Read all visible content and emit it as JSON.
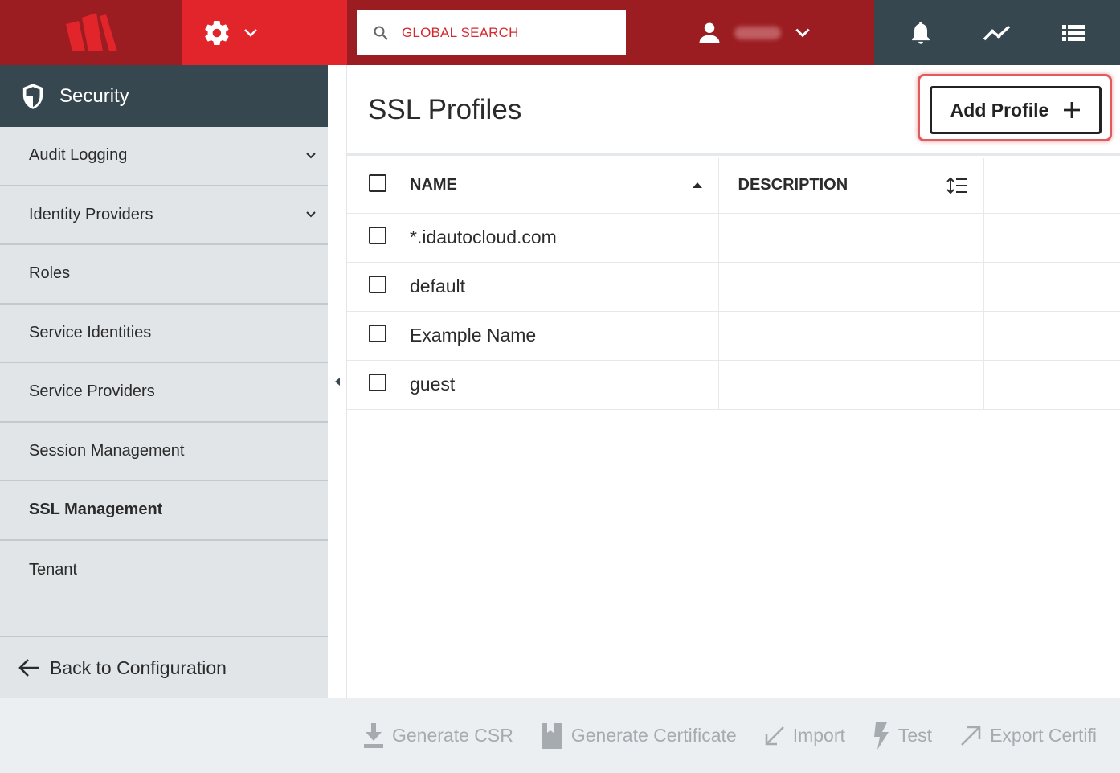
{
  "topbar": {
    "search": {
      "placeholder": "GLOBAL SEARCH"
    },
    "icons": [
      "logo-icon",
      "gear-icon",
      "chevron-down-icon",
      "search-icon",
      "user-icon",
      "bell-icon",
      "activity-icon",
      "list-icon"
    ]
  },
  "sidebar": {
    "title": "Security",
    "items": [
      {
        "label": "Audit Logging",
        "expandable": true
      },
      {
        "label": "Identity Providers",
        "expandable": true
      },
      {
        "label": "Roles",
        "expandable": false
      },
      {
        "label": "Service Identities",
        "expandable": false
      },
      {
        "label": "Service Providers",
        "expandable": false
      },
      {
        "label": "Session Management",
        "expandable": false
      },
      {
        "label": "SSL Management",
        "expandable": false,
        "active": true
      },
      {
        "label": "Tenant",
        "expandable": false
      }
    ],
    "back_label": "Back to Configuration"
  },
  "main": {
    "title": "SSL Profiles",
    "add_button_label": "Add Profile",
    "table": {
      "columns": [
        "NAME",
        "DESCRIPTION"
      ],
      "rows": [
        {
          "name": "*.idautocloud.com",
          "description": ""
        },
        {
          "name": "default",
          "description": ""
        },
        {
          "name": "Example Name",
          "description": ""
        },
        {
          "name": "guest",
          "description": ""
        }
      ]
    }
  },
  "actions": {
    "generate_csr": "Generate CSR",
    "generate_certificate": "Generate Certificate",
    "import": "Import",
    "test": "Test",
    "export": "Export Certifi"
  },
  "colors": {
    "brand_dark_red": "#9b1c21",
    "brand_red": "#e2242b",
    "slate": "#37474f",
    "sidebar_bg": "#e1e5e8",
    "highlight": "#e05a5e",
    "disabled_text": "#a5abaf"
  }
}
